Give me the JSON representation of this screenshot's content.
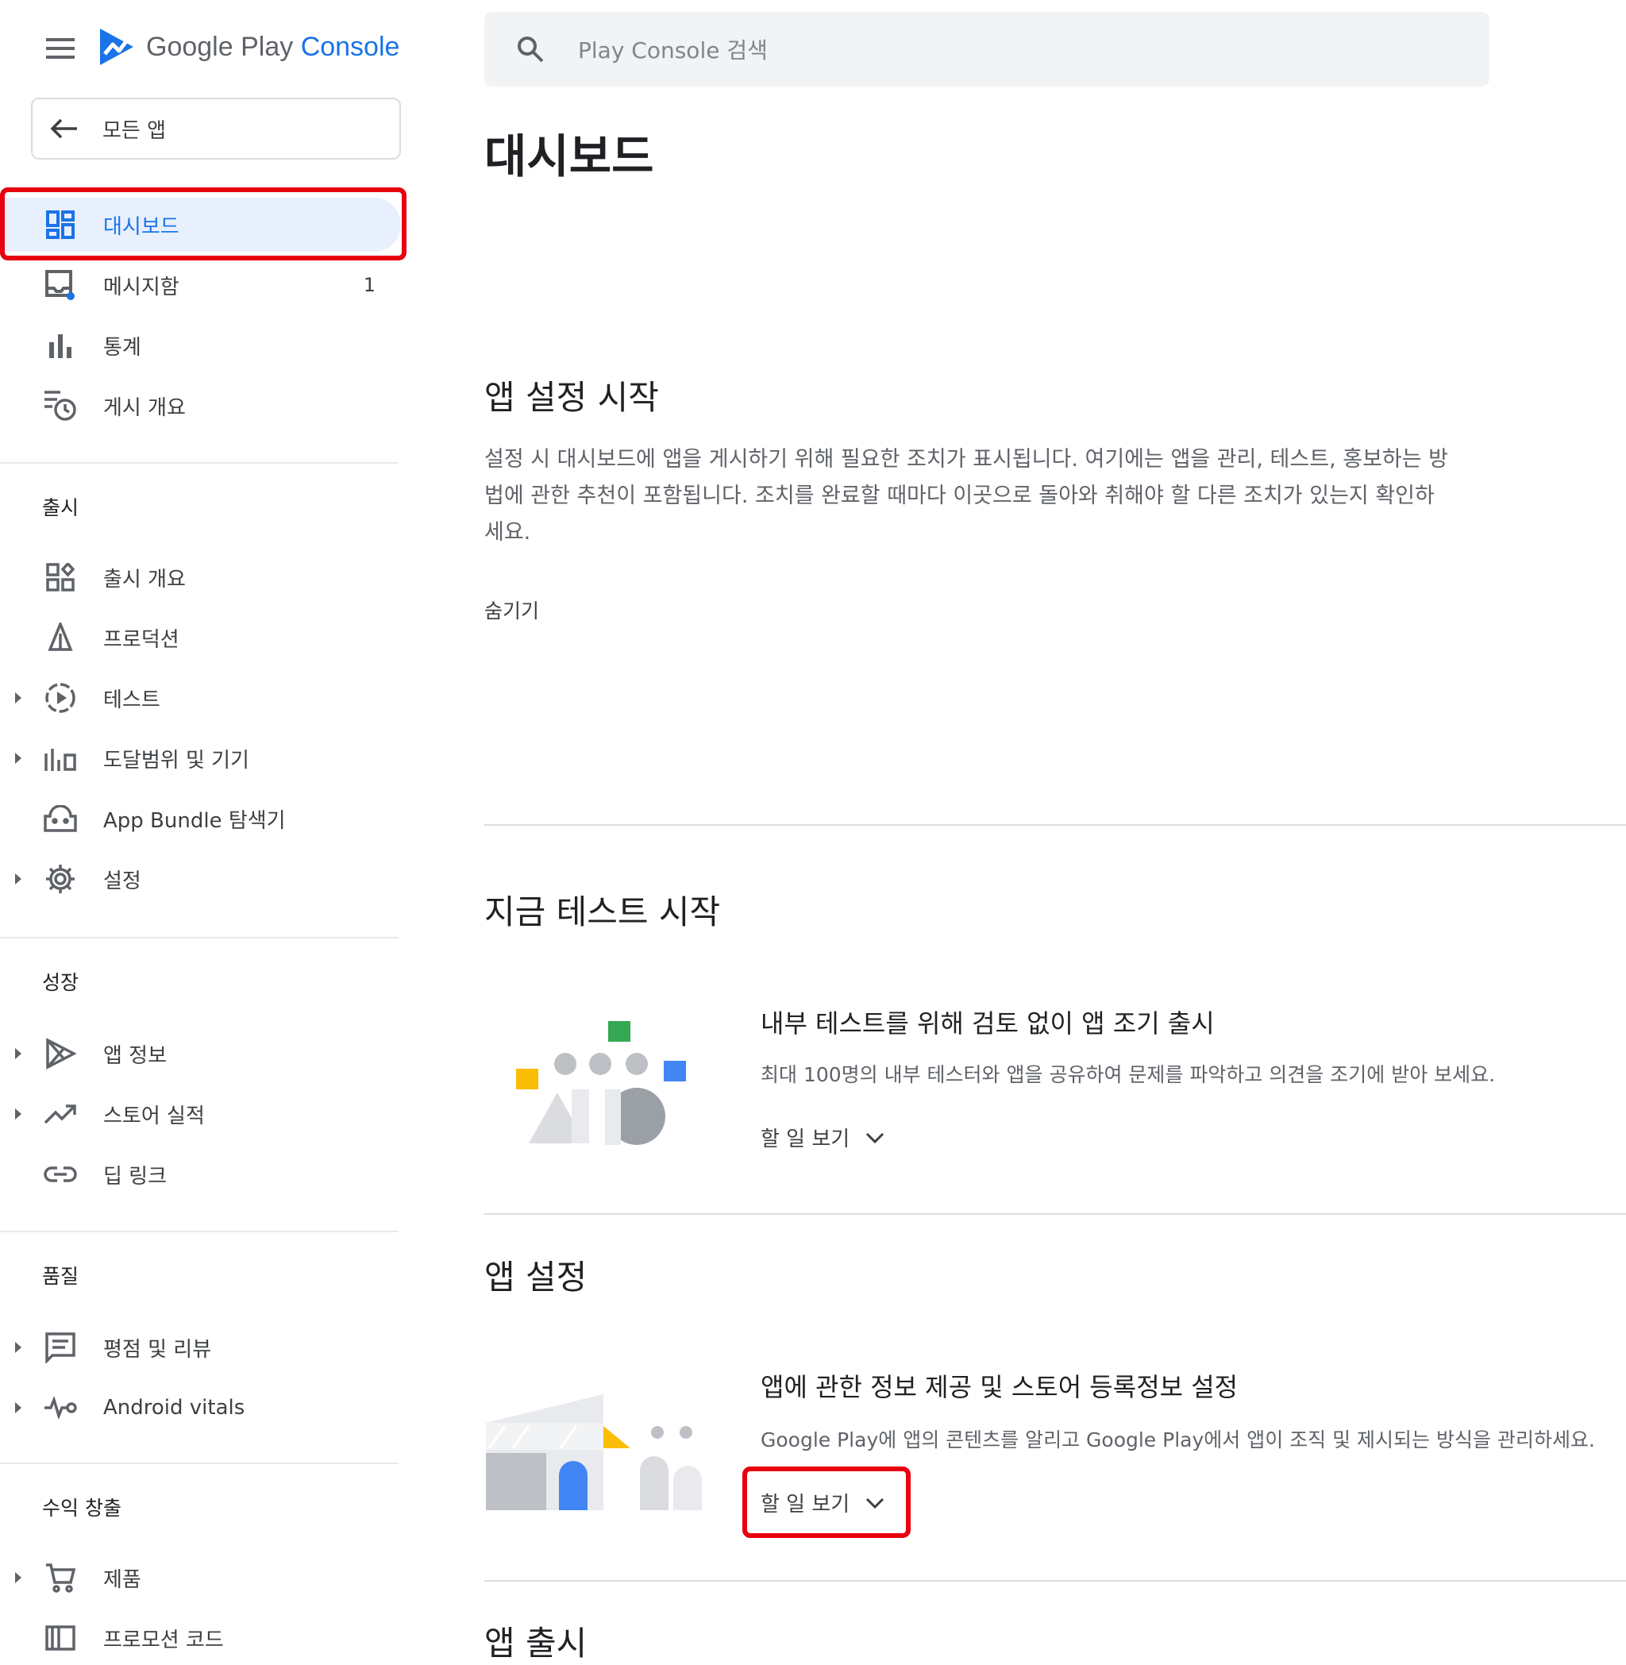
{
  "app": {
    "logo_google_play": "Google Play",
    "logo_console": "Console",
    "brand_color": "#1a73e8"
  },
  "sidebar": {
    "all_apps": "모든 앱",
    "items_top": [
      {
        "label": "대시보드",
        "icon": "dashboard-icon",
        "active": true
      },
      {
        "label": "메시지함",
        "icon": "inbox-icon",
        "count": "1"
      },
      {
        "label": "통계",
        "icon": "bar-chart-icon"
      },
      {
        "label": "게시 개요",
        "icon": "publishing-overview-icon"
      }
    ],
    "sections": [
      {
        "title": "출시",
        "items": [
          {
            "label": "출시 개요",
            "icon": "release-overview-icon"
          },
          {
            "label": "프로덕션",
            "icon": "production-icon"
          },
          {
            "label": "테스트",
            "icon": "testing-icon"
          },
          {
            "label": "도달범위 및 기기",
            "icon": "reach-devices-icon"
          },
          {
            "label": "App Bundle 탐색기",
            "icon": "android-icon"
          },
          {
            "label": "설정",
            "icon": "gear-icon"
          }
        ]
      },
      {
        "title": "성장",
        "items": [
          {
            "label": "앱 정보",
            "icon": "play-icon"
          },
          {
            "label": "스토어 실적",
            "icon": "trending-icon"
          },
          {
            "label": "딥 링크",
            "icon": "link-icon"
          }
        ]
      },
      {
        "title": "품질",
        "items": [
          {
            "label": "평점 및 리뷰",
            "icon": "reviews-icon"
          },
          {
            "label": "Android vitals",
            "icon": "vitals-icon"
          }
        ]
      },
      {
        "title": "수익 창출",
        "items": [
          {
            "label": "제품",
            "icon": "cart-icon"
          },
          {
            "label": "프로모션 코드",
            "icon": "promo-code-icon"
          }
        ]
      }
    ]
  },
  "search": {
    "placeholder": "Play Console 검색"
  },
  "main": {
    "title": "대시보드",
    "setup": {
      "heading": "앱 설정 시작",
      "description": "설정 시 대시보드에 앱을 게시하기 위해 필요한 조치가 표시됩니다. 여기에는 앱을 관리, 테스트, 홍보하는 방법에 관한 추천이 포함됩니다. 조치를 완료할 때마다 이곳으로 돌아와 취해야 할 다른 조치가 있는지 확인하세요.",
      "hide": "숨기기"
    },
    "test_section": {
      "heading": "지금 테스트 시작",
      "card_title": "내부 테스트를 위해 검토 없이 앱 조기 출시",
      "card_desc": "최대 100명의 내부 테스터와 앱을 공유하여 문제를 파악하고 의견을 조기에 받아 보세요.",
      "todo": "할 일 보기"
    },
    "app_setup_section": {
      "heading": "앱 설정",
      "card_title": "앱에 관한 정보 제공 및 스토어 등록정보 설정",
      "card_desc": "Google Play에 앱의 콘텐츠를 알리고 Google Play에서 앱이 조직 및 제시되는 방식을 관리하세요.",
      "todo": "할 일 보기"
    },
    "release_section": {
      "heading": "앱 출시"
    }
  }
}
